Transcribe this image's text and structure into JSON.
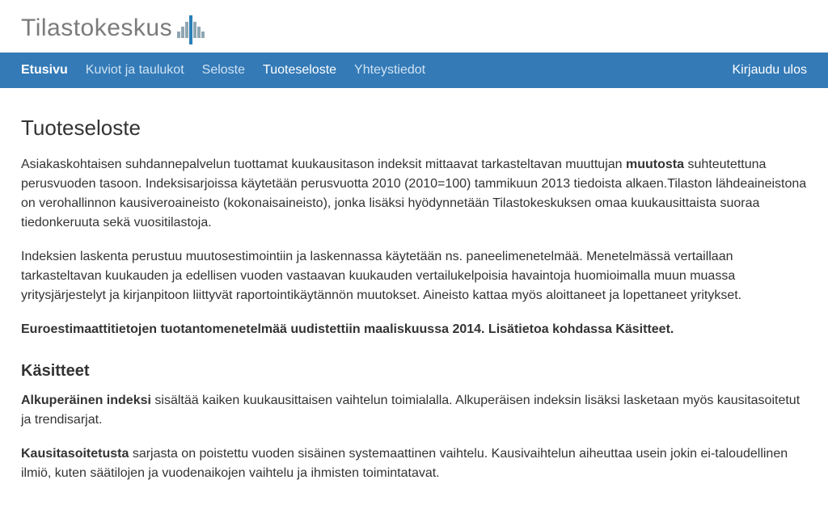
{
  "brand": {
    "name": "Tilastokeskus"
  },
  "nav": {
    "items": [
      {
        "label": "Etusivu"
      },
      {
        "label": "Kuviot ja taulukot"
      },
      {
        "label": "Seloste"
      },
      {
        "label": "Tuoteseloste"
      },
      {
        "label": "Yhteystiedot"
      }
    ],
    "logout": "Kirjaudu ulos"
  },
  "content": {
    "title": "Tuoteseloste",
    "p1": {
      "t1": "Asiakaskohtaisen suhdannepalvelun tuottamat kuukausitason indeksit mittaavat tarkasteltavan muuttujan ",
      "b1": "muutosta",
      "t2": " suhteutettuna perusvuoden tasoon. Indeksisarjoissa käytetään perusvuotta 2010 (2010=100) tammikuun 2013 tiedoista alkaen.Tilaston lähdeaineistona on verohallinnon kausiveroaineisto (kokonaisaineisto), jonka lisäksi hyödynnetään Tilastokeskuksen omaa kuukausittaista suoraa tiedonkeruuta sekä vuositilastoja."
    },
    "p2": "Indeksien laskenta perustuu muutosestimointiin ja laskennassa käytetään ns. paneelimenetelmää. Menetelmässä vertaillaan tarkasteltavan kuukauden ja edellisen vuoden vastaavan kuukauden vertailukelpoisia havaintoja huomioimalla muun muassa yritysjärjestelyt ja kirjanpitoon liittyvät raportointikäytännön muutokset. Aineisto kattaa myös aloittaneet ja lopettaneet yritykset.",
    "p3": "Euroestimaattitietojen tuotantomenetelmää uudistettiin maaliskuussa 2014. Lisätietoa kohdassa Käsitteet.",
    "section2_title": "Käsitteet",
    "p4": {
      "b1": "Alkuperäinen indeksi",
      "t1": " sisältää kaiken kuukausittaisen vaihtelun toimialalla. Alkuperäisen indeksin lisäksi lasketaan myös kausitasoitetut ja trendisarjat."
    },
    "p5": {
      "b1": "Kausitasoitetusta",
      "t1": " sarjasta on poistettu vuoden sisäinen systemaattinen vaihtelu. Kausivaihtelun aiheuttaa usein jokin ei-taloudellinen ilmiö, kuten säätilojen ja vuodenaikojen vaihtelu ja ihmisten toimintatavat."
    }
  }
}
